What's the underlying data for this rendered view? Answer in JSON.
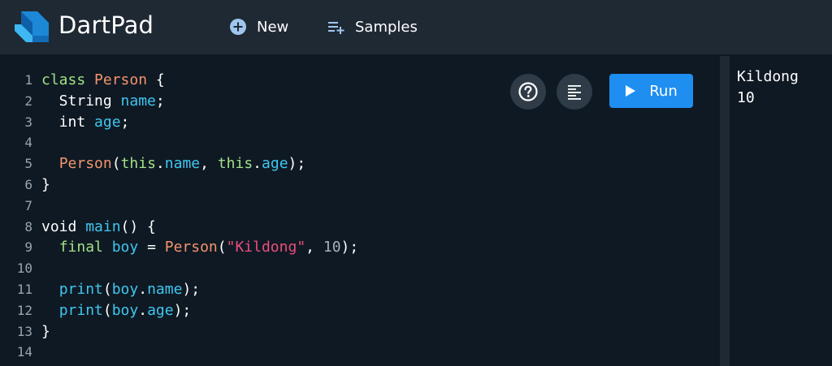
{
  "header": {
    "title": "DartPad",
    "new_label": "New",
    "samples_label": "Samples",
    "logo_icon": "dart-logo-icon",
    "new_icon": "add-circle-icon",
    "samples_icon": "playlist-add-icon"
  },
  "editor": {
    "line_numbers": [
      "1",
      "2",
      "3",
      "4",
      "5",
      "6",
      "7",
      "8",
      "9",
      "10",
      "11",
      "12",
      "13",
      "14"
    ],
    "lines": [
      [
        {
          "t": "class",
          "c": "kw"
        },
        {
          "t": " ",
          "c": "pn"
        },
        {
          "t": "Person",
          "c": "cls"
        },
        {
          "t": " {",
          "c": "pn"
        }
      ],
      [
        {
          "t": "  String ",
          "c": "pn"
        },
        {
          "t": "name",
          "c": "fld"
        },
        {
          "t": ";",
          "c": "pn"
        }
      ],
      [
        {
          "t": "  int ",
          "c": "pn"
        },
        {
          "t": "age",
          "c": "fld"
        },
        {
          "t": ";",
          "c": "pn"
        }
      ],
      [],
      [
        {
          "t": "  ",
          "c": "pn"
        },
        {
          "t": "Person",
          "c": "cls"
        },
        {
          "t": "(",
          "c": "pn"
        },
        {
          "t": "this",
          "c": "kw"
        },
        {
          "t": ".",
          "c": "pn"
        },
        {
          "t": "name",
          "c": "fld"
        },
        {
          "t": ", ",
          "c": "pn"
        },
        {
          "t": "this",
          "c": "kw"
        },
        {
          "t": ".",
          "c": "pn"
        },
        {
          "t": "age",
          "c": "fld"
        },
        {
          "t": ");",
          "c": "pn"
        }
      ],
      [
        {
          "t": "}",
          "c": "pn"
        }
      ],
      [],
      [
        {
          "t": "void ",
          "c": "pn"
        },
        {
          "t": "main",
          "c": "fld"
        },
        {
          "t": "() {",
          "c": "pn"
        }
      ],
      [
        {
          "t": "  ",
          "c": "pn"
        },
        {
          "t": "final",
          "c": "kw"
        },
        {
          "t": " ",
          "c": "pn"
        },
        {
          "t": "boy",
          "c": "fld"
        },
        {
          "t": " = ",
          "c": "pn"
        },
        {
          "t": "Person",
          "c": "cls"
        },
        {
          "t": "(",
          "c": "pn"
        },
        {
          "t": "\"Kildong\"",
          "c": "str"
        },
        {
          "t": ", ",
          "c": "pn"
        },
        {
          "t": "10",
          "c": "num"
        },
        {
          "t": ");",
          "c": "pn"
        }
      ],
      [],
      [
        {
          "t": "  ",
          "c": "pn"
        },
        {
          "t": "print",
          "c": "fld"
        },
        {
          "t": "(",
          "c": "pn"
        },
        {
          "t": "boy",
          "c": "fld"
        },
        {
          "t": ".",
          "c": "pn"
        },
        {
          "t": "name",
          "c": "fld"
        },
        {
          "t": ");",
          "c": "pn"
        }
      ],
      [
        {
          "t": "  ",
          "c": "pn"
        },
        {
          "t": "print",
          "c": "fld"
        },
        {
          "t": "(",
          "c": "pn"
        },
        {
          "t": "boy",
          "c": "fld"
        },
        {
          "t": ".",
          "c": "pn"
        },
        {
          "t": "age",
          "c": "fld"
        },
        {
          "t": ");",
          "c": "pn"
        }
      ],
      [
        {
          "t": "}",
          "c": "pn"
        }
      ],
      []
    ],
    "help_icon": "help-icon",
    "format_icon": "format-align-icon",
    "run_label": "Run",
    "run_icon": "play-icon"
  },
  "output": {
    "lines": [
      "Kildong",
      "10"
    ]
  },
  "colors": {
    "header_bg": "#1e2933",
    "editor_bg": "#0f1923",
    "run_button": "#1f8ef1",
    "keyword": "#a0e088",
    "class_name": "#f2946d",
    "identifier": "#3fc6f0",
    "string": "#ea4f7c"
  }
}
